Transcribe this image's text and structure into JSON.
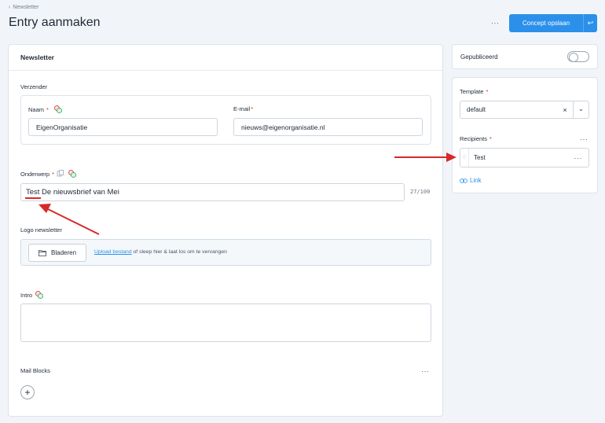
{
  "breadcrumb": {
    "arrow": "‹",
    "label": "Newsletter"
  },
  "page": {
    "title": "Entry aanmaken"
  },
  "toolbar": {
    "more": "···",
    "save_label": "Concept opslaan",
    "save_split": "↩"
  },
  "main": {
    "card_title": "Newsletter",
    "sender": {
      "section_label": "Verzender",
      "name_label": "Naam",
      "name_required": "*",
      "name_value": "EigenOrganisatie",
      "email_label": "E-mail",
      "email_required": "*",
      "email_value": "nieuws@eigenorganisatie.nl"
    },
    "subject": {
      "label": "Onderwerp",
      "required": "*",
      "value": "Test De nieuwsbrief van Mei",
      "counter": "27/100"
    },
    "logo": {
      "label": "Logo newsletter",
      "browse_label": "Bladeren",
      "upload_link": "Upload bestand",
      "upload_text": " of sleep hier & laat los om te vervangen"
    },
    "intro": {
      "label": "Intro",
      "value": ""
    },
    "mail_blocks": {
      "label": "Mail Blocks",
      "more": "···",
      "add": "+"
    }
  },
  "sidebar": {
    "published_label": "Gepubliceerd",
    "published": false,
    "template": {
      "label": "Template",
      "required": "*",
      "value": "default",
      "clear": "×",
      "chevron": "⌄"
    },
    "recipients": {
      "label": "Recipients",
      "required": "*",
      "more": "···",
      "items": [
        {
          "label": "Test",
          "more": "···"
        }
      ],
      "link_label": "Link"
    }
  },
  "colors": {
    "accent": "#2b90e9",
    "required": "#dc2626",
    "annotation_arrow": "#d62a2a"
  }
}
